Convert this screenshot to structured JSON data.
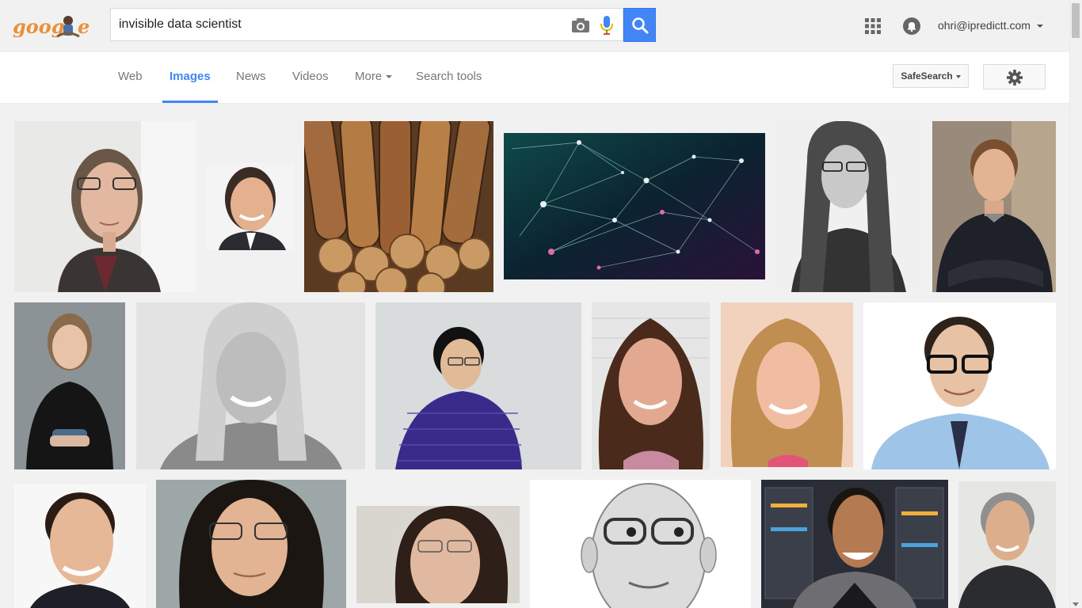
{
  "header": {
    "logo_text": "google",
    "search_query": "invisible data scientist",
    "account_email": "ohri@ipredictt.com"
  },
  "nav": {
    "tabs": [
      {
        "label": "Web"
      },
      {
        "label": "Images"
      },
      {
        "label": "News"
      },
      {
        "label": "Videos"
      },
      {
        "label": "More"
      },
      {
        "label": "Search tools"
      }
    ],
    "active_tab": "Images",
    "safesearch_label": "SafeSearch"
  },
  "results": [
    {
      "kind": "portrait",
      "desc": "woman with glasses"
    },
    {
      "kind": "portrait",
      "desc": "man smiling"
    },
    {
      "kind": "cigars"
    },
    {
      "kind": "network"
    },
    {
      "kind": "portrait-bw",
      "desc": "woman with glasses"
    },
    {
      "kind": "portrait",
      "desc": "man arms crossed"
    },
    {
      "kind": "portrait",
      "desc": "woman in black"
    },
    {
      "kind": "portrait-bw",
      "desc": "smiling blonde woman"
    },
    {
      "kind": "portrait",
      "desc": "man in purple shirt"
    },
    {
      "kind": "portrait",
      "desc": "woman curly hair"
    },
    {
      "kind": "portrait",
      "desc": "blonde woman"
    },
    {
      "kind": "portrait",
      "desc": "man with glasses and tie"
    },
    {
      "kind": "portrait",
      "desc": "man in suit"
    },
    {
      "kind": "portrait",
      "desc": "woman with glasses"
    },
    {
      "kind": "portrait",
      "desc": "woman with glasses"
    },
    {
      "kind": "portrait-bw",
      "desc": "bald man with glasses"
    },
    {
      "kind": "portrait",
      "desc": "man laughing"
    },
    {
      "kind": "portrait",
      "desc": "grey haired man"
    }
  ],
  "colors": {
    "accent": "#4285f4",
    "header_bg": "#f1f1f1",
    "nav_bg": "#ffffff"
  },
  "icons": [
    "camera-icon",
    "microphone-icon",
    "search-icon",
    "apps-grid-icon",
    "notifications-icon",
    "gear-icon"
  ]
}
